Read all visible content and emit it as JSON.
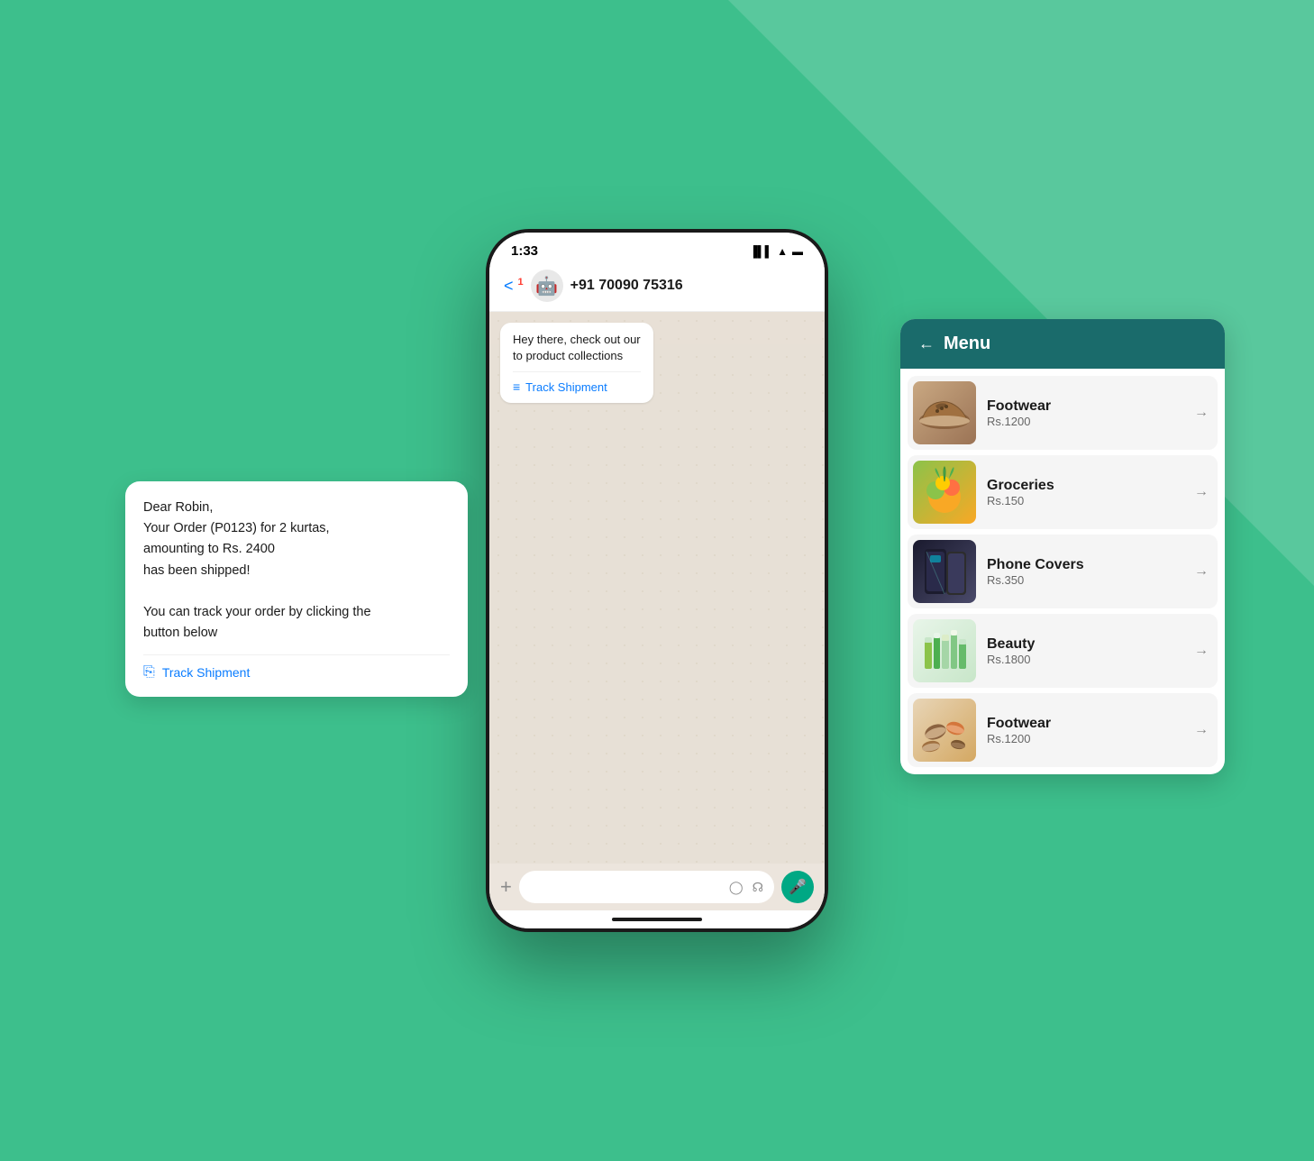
{
  "background": {
    "color": "#3dbf8c"
  },
  "phone": {
    "status_bar": {
      "time": "1:33",
      "signal": "📶",
      "wifi": "📡",
      "battery": "🔋"
    },
    "chat_header": {
      "back": "< 1",
      "avatar_emoji": "🤖",
      "phone_number": "+91 70090 75316"
    },
    "message_1": {
      "text": "Hey there, check out our\nto product collections",
      "link_label": "Track Shipment",
      "link_icon": "≡"
    },
    "input_bar": {
      "plus": "+",
      "mic_icon": "🎤"
    }
  },
  "order_bubble": {
    "greeting": "Dear Robin,",
    "line1": "Your Order (P0123) for 2 kurtas,",
    "line2": "amounting to Rs. 2400",
    "line3": "has been shipped!",
    "line4": "",
    "line5": "You can track your order by clicking the",
    "line6": "button below",
    "track_label": "Track Shipment",
    "track_icon": "⊡"
  },
  "menu_card": {
    "header": {
      "back_arrow": "←",
      "title": "Menu"
    },
    "items": [
      {
        "name": "Footwear",
        "price": "Rs.1200",
        "category": "footwear1"
      },
      {
        "name": "Groceries",
        "price": "Rs.150",
        "category": "groceries"
      },
      {
        "name": "Phone Covers",
        "price": "Rs.350",
        "category": "phones"
      },
      {
        "name": "Beauty",
        "price": "Rs.1800",
        "category": "beauty"
      },
      {
        "name": "Footwear",
        "price": "Rs.1200",
        "category": "footwear2"
      }
    ]
  }
}
